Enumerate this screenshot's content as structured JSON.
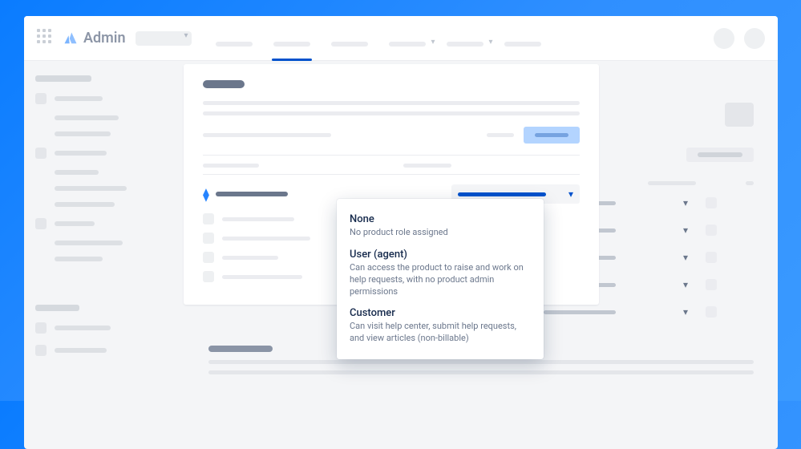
{
  "header": {
    "brand": "Admin"
  },
  "modal": {
    "selected_role_indicator": "role-selected"
  },
  "dropdown": {
    "options": [
      {
        "title": "None",
        "desc": "No product role assigned"
      },
      {
        "title": "User (agent)",
        "desc": "Can access the product to raise and work on help requests, with no product admin permissions"
      },
      {
        "title": "Customer",
        "desc": "Can visit help center, submit help requests, and view articles (non-billable)"
      }
    ]
  }
}
